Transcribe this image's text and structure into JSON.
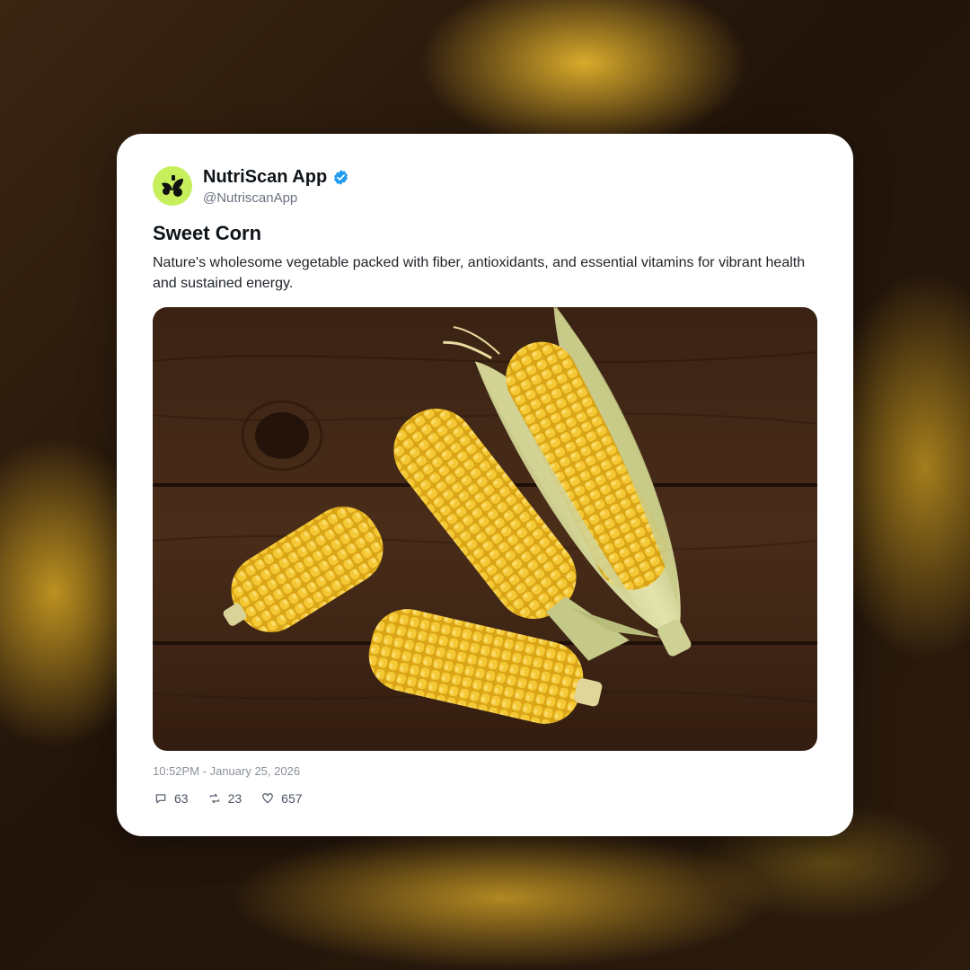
{
  "post": {
    "display_name": "NutriScan App",
    "handle": "@NutriscanApp",
    "verified_icon": "verified-badge-icon",
    "title": "Sweet Corn",
    "description": "Nature's wholesome vegetable packed with fiber, antioxidants, and essential vitamins for vibrant health and sustained energy.",
    "timestamp": "10:52PM - January 25, 2026",
    "stats": {
      "replies": "63",
      "reposts": "23",
      "likes": "657"
    }
  },
  "colors": {
    "avatar_bg": "#c6ef5b",
    "verified": "#1d9bf0",
    "corn": "#f2c230",
    "wood": "#3b2314"
  }
}
